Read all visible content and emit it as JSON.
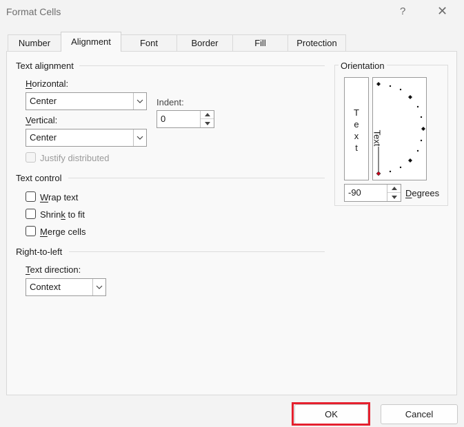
{
  "window": {
    "title": "Format Cells",
    "help_label": "?",
    "close_label": "✕"
  },
  "tabs": [
    {
      "label": "Number"
    },
    {
      "label": "Alignment",
      "active": true
    },
    {
      "label": "Font"
    },
    {
      "label": "Border"
    },
    {
      "label": "Fill"
    },
    {
      "label": "Protection"
    }
  ],
  "text_alignment": {
    "group_label": "Text alignment",
    "horizontal_label_key": "H",
    "horizontal_label_rest": "orizontal:",
    "horizontal_value": "Center",
    "vertical_label_key": "V",
    "vertical_label_rest": "ertical:",
    "vertical_value": "Center",
    "indent_label": "Indent:",
    "indent_value": "0",
    "justify_distributed_label": "Justify distributed",
    "justify_distributed_checked": false,
    "justify_distributed_enabled": false
  },
  "text_control": {
    "group_label": "Text control",
    "wrap_key": "W",
    "wrap_rest": "rap text",
    "wrap_checked": false,
    "shrink_pre": "Shrin",
    "shrink_key": "k",
    "shrink_post": " to fit",
    "shrink_checked": false,
    "merge_key": "M",
    "merge_rest": "erge cells",
    "merge_checked": false
  },
  "right_to_left": {
    "group_label": "Right-to-left",
    "direction_label_key": "T",
    "direction_label_rest": "ext direction:",
    "direction_value": "Context"
  },
  "orientation": {
    "group_label": "Orientation",
    "vertical_text_letters": [
      "T",
      "e",
      "x",
      "t"
    ],
    "dial_text": "Text",
    "degrees_value": "-90",
    "degrees_label_key": "D",
    "degrees_label_rest": "egrees",
    "marker_color": "#d0021b"
  },
  "buttons": {
    "ok_label": "OK",
    "cancel_label": "Cancel"
  },
  "highlight_color": "#e5202e"
}
